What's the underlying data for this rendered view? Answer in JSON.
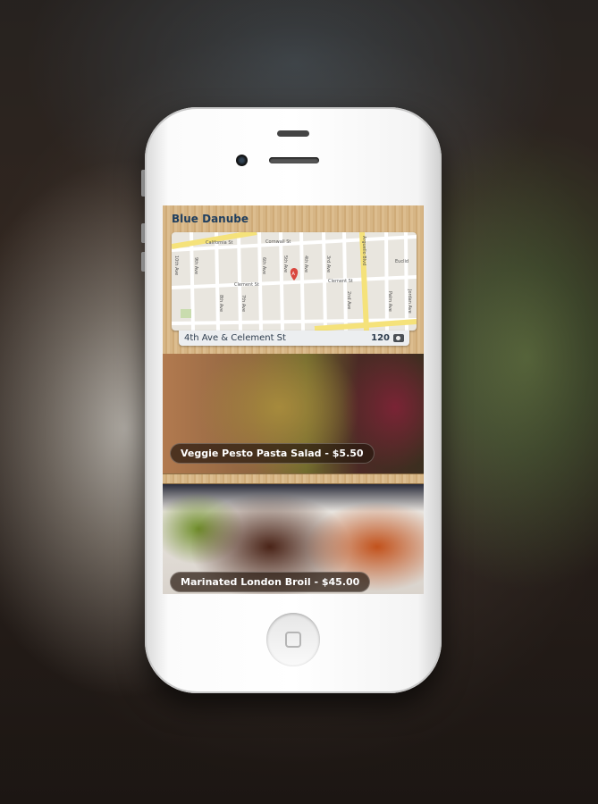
{
  "app": {
    "restaurant_name": "Blue Danube"
  },
  "map": {
    "location": "4th Ave & Celement St",
    "photo_count": "120",
    "photo_icon": "camera-icon",
    "pin_label": "A",
    "streets": [
      "California St",
      "Cornwall St",
      "Clement St",
      "Arguello Blvd",
      "10th Ave",
      "9th Ave",
      "8th Ave",
      "7th Ave",
      "6th Ave",
      "5th Ave",
      "4th Ave",
      "3rd Ave",
      "2nd Ave",
      "Palm Ave",
      "Jordan Ave",
      "Euclid"
    ]
  },
  "dishes": [
    {
      "caption": "Veggie Pesto Pasta Salad - $5.50"
    },
    {
      "caption": "Marinated London Broil - $45.00"
    }
  ]
}
